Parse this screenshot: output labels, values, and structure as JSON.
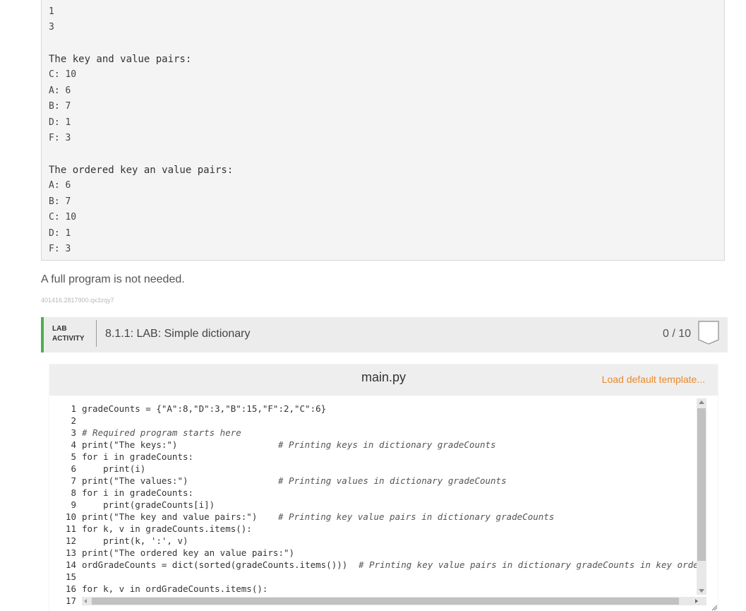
{
  "output": {
    "lines": [
      "1",
      "3",
      "",
      "The key and value pairs:",
      "C: 10",
      "A: 6",
      "B: 7",
      "D: 1",
      "F: 3",
      "",
      "The ordered key an value pairs:",
      "A: 6",
      "B: 7",
      "C: 10",
      "D: 1",
      "F: 3"
    ]
  },
  "note": "A full program is not needed.",
  "id_text": "401416.2817900.qx3zqy7",
  "lab": {
    "tag_line1": "LAB",
    "tag_line2": "ACTIVITY",
    "title": "8.1.1: LAB: Simple dictionary",
    "score": "0 / 10"
  },
  "editor": {
    "file_name": "main.py",
    "load_template": "Load default template...",
    "code_lines": [
      {
        "n": "1",
        "code": "gradeCounts = {\"A\":8,\"D\":3,\"B\":15,\"F\":2,\"C\":6}",
        "comment": ""
      },
      {
        "n": "2",
        "code": "",
        "comment": ""
      },
      {
        "n": "3",
        "code": "",
        "comment": "# Required program starts here"
      },
      {
        "n": "4",
        "code": "print(\"The keys:\")",
        "comment": "# Printing keys in dictionary gradeCounts"
      },
      {
        "n": "5",
        "code": "for i in gradeCounts:",
        "comment": ""
      },
      {
        "n": "6",
        "code": "    print(i)",
        "comment": ""
      },
      {
        "n": "7",
        "code": "print(\"The values:\")",
        "comment": "# Printing values in dictionary gradeCounts"
      },
      {
        "n": "8",
        "code": "for i in gradeCounts:",
        "comment": ""
      },
      {
        "n": "9",
        "code": "    print(gradeCounts[i])",
        "comment": ""
      },
      {
        "n": "10",
        "code": "print(\"The key and value pairs:\")",
        "comment": "# Printing key value pairs in dictionary gradeCounts"
      },
      {
        "n": "11",
        "code": "for k, v in gradeCounts.items():",
        "comment": ""
      },
      {
        "n": "12",
        "code": "    print(k, ':', v)",
        "comment": ""
      },
      {
        "n": "13",
        "code": "print(\"The ordered key an value pairs:\")",
        "comment": ""
      },
      {
        "n": "14",
        "code": "ordGradeCounts = dict(sorted(gradeCounts.items()))",
        "comment": "# Printing key value pairs in dictionary gradeCounts in key orde"
      },
      {
        "n": "15",
        "code": "",
        "comment": ""
      },
      {
        "n": "16",
        "code": "for k, v in ordGradeCounts.items():",
        "comment": ""
      },
      {
        "n": "17",
        "code": "",
        "comment": ""
      }
    ]
  },
  "colors": {
    "accent_green": "#4caf50",
    "load_orange": "#e88a2e"
  }
}
